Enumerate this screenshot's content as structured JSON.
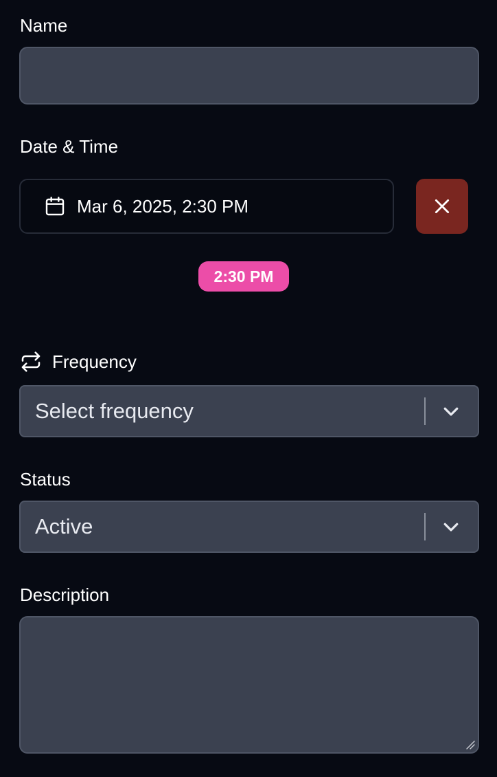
{
  "name": {
    "label": "Name",
    "value": ""
  },
  "datetime": {
    "label": "Date & Time",
    "value": "Mar 6, 2025, 2:30 PM",
    "time_pill": "2:30 PM",
    "calendar_icon": "calendar-icon",
    "clear_icon": "close-icon"
  },
  "frequency": {
    "label": "Frequency",
    "icon": "repeat-icon",
    "placeholder": "Select frequency"
  },
  "status": {
    "label": "Status",
    "value": "Active"
  },
  "description": {
    "label": "Description",
    "value": ""
  },
  "colors": {
    "background": "#070a13",
    "input_bg": "#3b4150",
    "clear_button": "#7a2620",
    "time_pill": "#ec4da8"
  }
}
